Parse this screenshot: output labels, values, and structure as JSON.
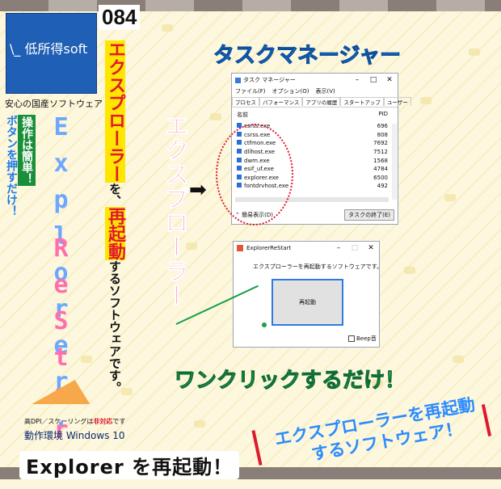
{
  "issue_number": "084",
  "logo": {
    "text": "\\_ 低所得soft",
    "tagline": "安心の国産ソフトウェア"
  },
  "vertical": {
    "op_line1": "操作は簡単！",
    "op_line2": "ボタンを押すだけ！",
    "explorer": "Explorer.",
    "restart": "ReStart",
    "desc_part1": "エクスプローラー",
    "desc_part2": "を、",
    "desc_part3": "再起動",
    "desc_part4": "するソフトウェアです。",
    "big": "エクスプローラー"
  },
  "notes": {
    "hidpi_prefix": "高DPI／スケーリングは",
    "hidpi_red": "非対応",
    "hidpi_suffix": "です",
    "env": "動作環境 Windows 10"
  },
  "headings": {
    "task_manager": "タスクマネージャー",
    "one_click": "ワンクリックするだけ！",
    "banner_line1": "エクスプローラーを再起動",
    "banner_line2": "するソフトウェア！",
    "bottom_caption": "Explorer を再起動！"
  },
  "task_manager": {
    "title": "タスク マネージャー",
    "menu": [
      "ファイル(F)",
      "オプション(O)",
      "表示(V)"
    ],
    "tabs": [
      "プロセス",
      "パフォーマンス",
      "アプリの履歴",
      "スタートアップ",
      "ユーザー"
    ],
    "columns": {
      "name": "名前",
      "pid": "PID"
    },
    "rows": [
      {
        "name": "csrss.exe",
        "pid": "696"
      },
      {
        "name": "csrss.exe",
        "pid": "808"
      },
      {
        "name": "ctfmon.exe",
        "pid": "7692"
      },
      {
        "name": "dllhost.exe",
        "pid": "7512"
      },
      {
        "name": "dwm.exe",
        "pid": "1568"
      },
      {
        "name": "esif_uf.exe",
        "pid": "4784"
      },
      {
        "name": "explorer.exe",
        "pid": "6500"
      },
      {
        "name": "fontdrvhost.exe",
        "pid": "492"
      }
    ],
    "footer_left": "簡易表示(D)",
    "end_task": "タスクの終了(E)"
  },
  "restart_window": {
    "title": "ExplorerReStart",
    "description": "エクスプローラーを再起動するソフトウェアです。",
    "button": "再起動",
    "beep": "Beep音"
  },
  "colors": {
    "accent_blue": "#2a8bff",
    "pink": "#ff5aa8",
    "logo_blue": "#1f5fb5",
    "green": "#1a9e4a"
  }
}
